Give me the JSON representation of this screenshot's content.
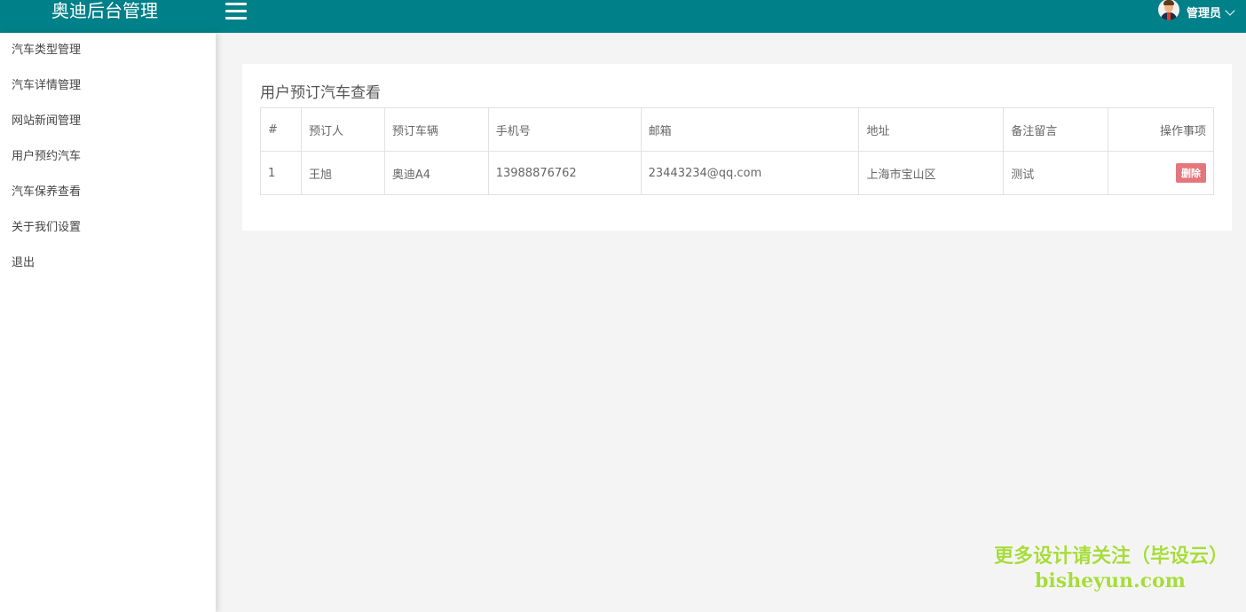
{
  "header": {
    "brand": "奥迪后台管理",
    "user_name": "管理员"
  },
  "sidebar": {
    "items": [
      {
        "label": "汽车类型管理"
      },
      {
        "label": "汽车详情管理"
      },
      {
        "label": "网站新闻管理"
      },
      {
        "label": "用户预约汽车"
      },
      {
        "label": "汽车保养查看"
      },
      {
        "label": "关于我们设置"
      },
      {
        "label": "退出"
      }
    ]
  },
  "main": {
    "title": "用户预订汽车查看",
    "columns": [
      "#",
      "预订人",
      "预订车辆",
      "手机号",
      "邮箱",
      "地址",
      "备注留言",
      "操作事项"
    ],
    "rows": [
      {
        "id": "1",
        "name": "王旭",
        "car": "奥迪A4",
        "phone": "13988876762",
        "email": "23443234@qq.com",
        "address": "上海市宝山区",
        "note": "测试",
        "action_label": "删除"
      }
    ]
  },
  "watermark": {
    "line1": "更多设计请关注（毕设云）",
    "line2": "bisheyun.com"
  },
  "colors": {
    "topbar": "#008089",
    "delete_button": "#e4767c",
    "watermark": "#a6dc3c"
  },
  "icons": {
    "menu": "hamburger-icon",
    "user": "avatar",
    "dropdown": "chevron-down-icon"
  }
}
